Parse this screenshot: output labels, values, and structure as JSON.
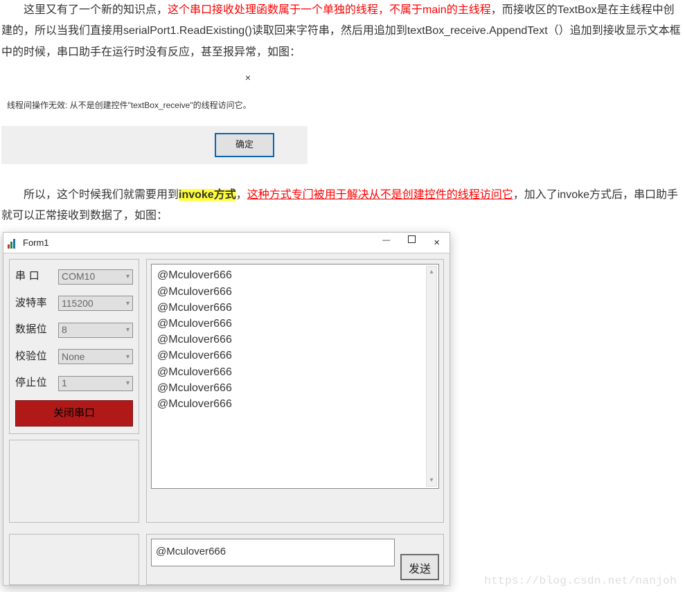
{
  "para1_a": "　　这里又有了一个新的知识点，",
  "para1_red": "这个串口接收处理函数属于一个单独的线程，不属于main的主线程",
  "para1_b": "，而接收区的TextBox是在主线程中创建的，所以当我们直接用serialPort1.ReadExisting()读取回来字符串，然后用追加到textBox_receive.AppendText（）追加到接收显示文本框中的时候，串口助手在运行时没有反应，甚至报异常，如图：",
  "dialog1_msg": "线程间操作无效: 从不是创建控件\"textBox_receive\"的线程访问它。",
  "dialog1_ok": "确定",
  "para2_a": "　　所以，这个时候我们就需要用到",
  "para2_hl": "invoke方式",
  "para2_b": "，",
  "para2_red_u": "这种方式专门被用于解决从不是创建控件的线程访问它",
  "para2_c": "，加入了invoke方式后，串口助手就可以正常接收到数据了，如图：",
  "form": {
    "title": "Form1",
    "labels": {
      "port": "串  口",
      "baud": "波特率",
      "data": "数据位",
      "parity": "校验位",
      "stop": "停止位"
    },
    "values": {
      "port": "COM10",
      "baud": "115200",
      "data": "8",
      "parity": "None",
      "stop": "1"
    },
    "close_btn": "关闭串口",
    "send_btn": "发送",
    "tx": "@Mculover666",
    "rx_lines": [
      "@Mculover666",
      "@Mculover666",
      "@Mculover666",
      "@Mculover666",
      "@Mculover666",
      "@Mculover666",
      "@Mculover666",
      "@Mculover666",
      "@Mculover666"
    ]
  },
  "watermark": "https://blog.csdn.net/nanjoh"
}
